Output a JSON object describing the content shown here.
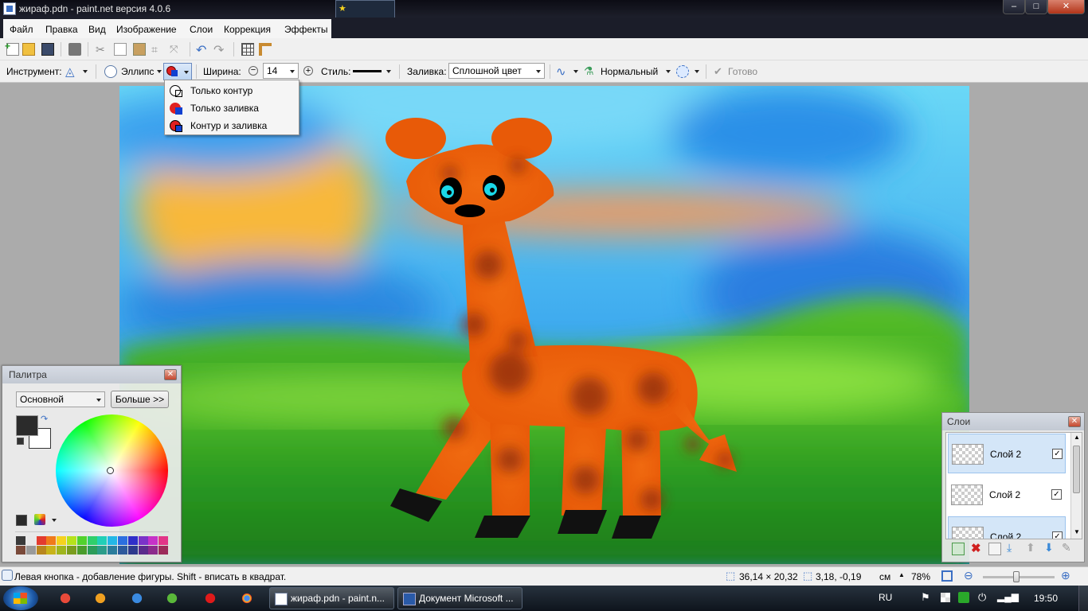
{
  "window": {
    "title": "жираф.pdn - paint.net версия 4.0.6",
    "minimize": "–",
    "maximize": "□",
    "close": "✕"
  },
  "menu": [
    "Файл",
    "Правка",
    "Вид",
    "Изображение",
    "Слои",
    "Коррекция",
    "Эффекты"
  ],
  "toolbar": {
    "tool_label": "Инструмент:",
    "shape_label": "Эллипс",
    "width_label": "Ширина:",
    "width_value": "14",
    "style_label": "Стиль:",
    "fill_label": "Заливка:",
    "fill_value": "Сплошной цвет",
    "blend_value": "Нормальный",
    "done_label": "Готово"
  },
  "fill_menu": {
    "items": [
      "Только контур",
      "Только заливка",
      "Контур и заливка"
    ]
  },
  "palette": {
    "title": "Палитра",
    "mode": "Основной",
    "more_button": "Больше >>",
    "primary_color": "#2b2b2b",
    "secondary_color": "#ffffff",
    "swatches_row1": [
      "#3a3a3a",
      "#e8e8e8",
      "#e33b2e",
      "#f07a1a",
      "#f5d21e",
      "#b6e21a",
      "#52d22c",
      "#2fcf6b",
      "#21cfb7",
      "#24b7e6",
      "#2b6fe0",
      "#2f2fc9",
      "#7b33c8",
      "#c632c8",
      "#e23588"
    ],
    "swatches_row2": [
      "#7a4a3a",
      "#9a9a9a",
      "#b8861e",
      "#c8b31a",
      "#9fb51e",
      "#7a9c1e",
      "#4a9c2c",
      "#2c9c5a",
      "#2c9c8a",
      "#2c7c9c",
      "#2c5a9c",
      "#2c3a8c",
      "#5a2c8c",
      "#8c2c8c",
      "#9c2c5a"
    ]
  },
  "layers": {
    "title": "Слои",
    "items": [
      {
        "name": "Слой 2",
        "visible": "✓"
      },
      {
        "name": "Слой 2",
        "visible": "✓"
      },
      {
        "name": "Слой 2",
        "visible": "✓"
      }
    ]
  },
  "status": {
    "hint": "Левая кнопка - добавление фигуры. Shift - вписать в квадрат.",
    "size": "36,14 × 20,32",
    "position": "3,18, -0,19",
    "units": "см",
    "zoom": "78%"
  },
  "taskbar": {
    "task1": "жираф.pdn - paint.n...",
    "task2": "Документ Microsoft ...",
    "lang": "RU",
    "clock": "19:50"
  },
  "colors": {
    "accent": "#3b6fc4",
    "giraffe_orange": "#f06010",
    "giraffe_spots": "#8a2a10"
  }
}
